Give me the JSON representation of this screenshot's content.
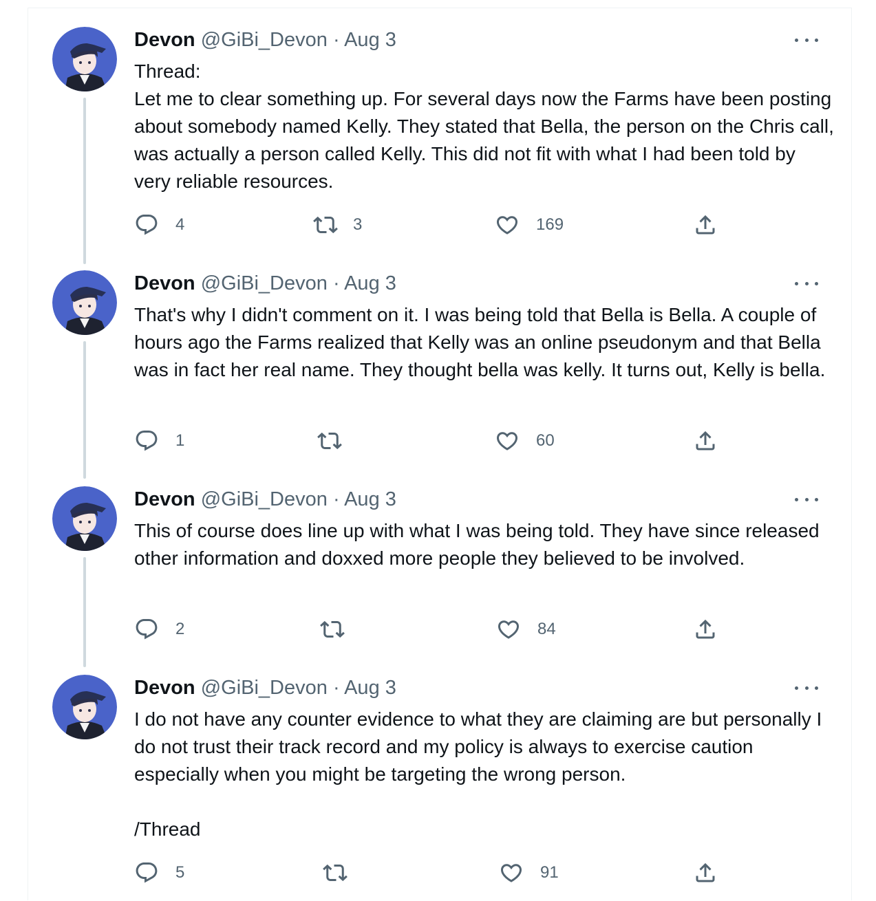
{
  "author": {
    "name": "Devon",
    "handle": "@GiBi_Devon",
    "separator": "·"
  },
  "icons": {
    "reply": "reply-icon",
    "retweet": "retweet-icon",
    "like": "like-icon",
    "share": "share-icon",
    "more": "more-icon"
  },
  "tweets": [
    {
      "date": "Aug 3",
      "text": "Thread:\nLet me to clear something up. For several days now the Farms have been posting about somebody named Kelly. They stated that Bella, the person on the Chris call, was actually a person called Kelly. This did not fit with what I had been told by very reliable resources.",
      "replies": "4",
      "retweets": "3",
      "likes": "169"
    },
    {
      "date": "Aug 3",
      "text": "That's why I didn't comment on it. I was being told that Bella is Bella. A couple of hours ago the Farms realized that Kelly was an online pseudonym and that Bella was in fact her real name. They thought bella was kelly. It turns out, Kelly is bella.",
      "replies": "1",
      "retweets": "",
      "likes": "60"
    },
    {
      "date": "Aug 3",
      "text": "This of course does line up with what I was being told. They have since released other information and doxxed more people they believed to be involved.",
      "replies": "2",
      "retweets": "",
      "likes": "84"
    },
    {
      "date": "Aug 3",
      "text": "I do not have any counter evidence to what they are claiming are but personally I do not trust their track record and my policy is always to exercise caution especially when you might be targeting the wrong person.\n\n/Thread",
      "replies": "5",
      "retweets": "",
      "likes": "91"
    }
  ]
}
